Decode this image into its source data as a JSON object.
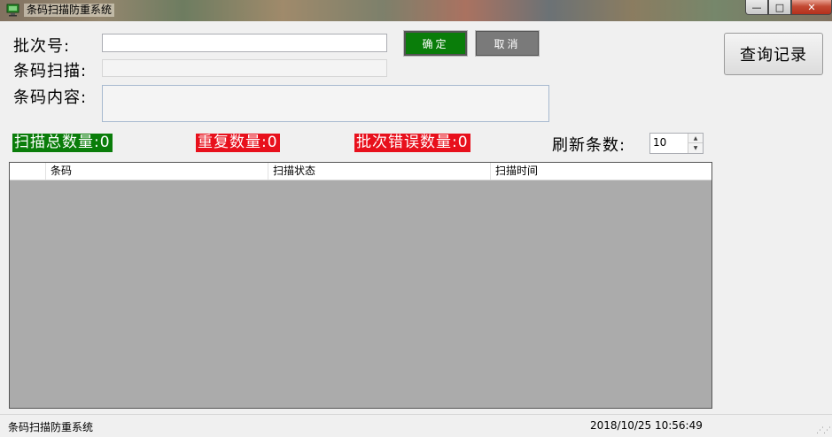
{
  "window": {
    "title": "条码扫描防重系统",
    "controls": {
      "minimize": "—",
      "maximize": "□",
      "close": "✕"
    }
  },
  "form": {
    "batch_label": "批次号:",
    "batch_value": "",
    "barcode_scan_label": "条码扫描:",
    "barcode_scan_value": "",
    "barcode_content_label": "条码内容:",
    "barcode_content_value": "",
    "ok_button": "确定",
    "cancel_button": "取消",
    "query_button": "查询记录"
  },
  "counters": {
    "total_scanned": "扫描总数量:0",
    "duplicate": "重复数量:0",
    "batch_error": "批次错误数量:0",
    "refresh_label": "刷新条数:",
    "refresh_value": "10"
  },
  "grid": {
    "columns": [
      "",
      "条码",
      "扫描状态",
      "扫描时间"
    ],
    "rows": []
  },
  "statusbar": {
    "left": "条码扫描防重系统",
    "right": "2018/10/25 10:56:49"
  },
  "colors": {
    "ok_green": "#0a7d0a",
    "alert_red": "#e8101c",
    "grid_bg": "#ababab"
  },
  "icons": {
    "app": "monitor-icon",
    "stepper_up": "triangle-up",
    "stepper_down": "triangle-down"
  }
}
